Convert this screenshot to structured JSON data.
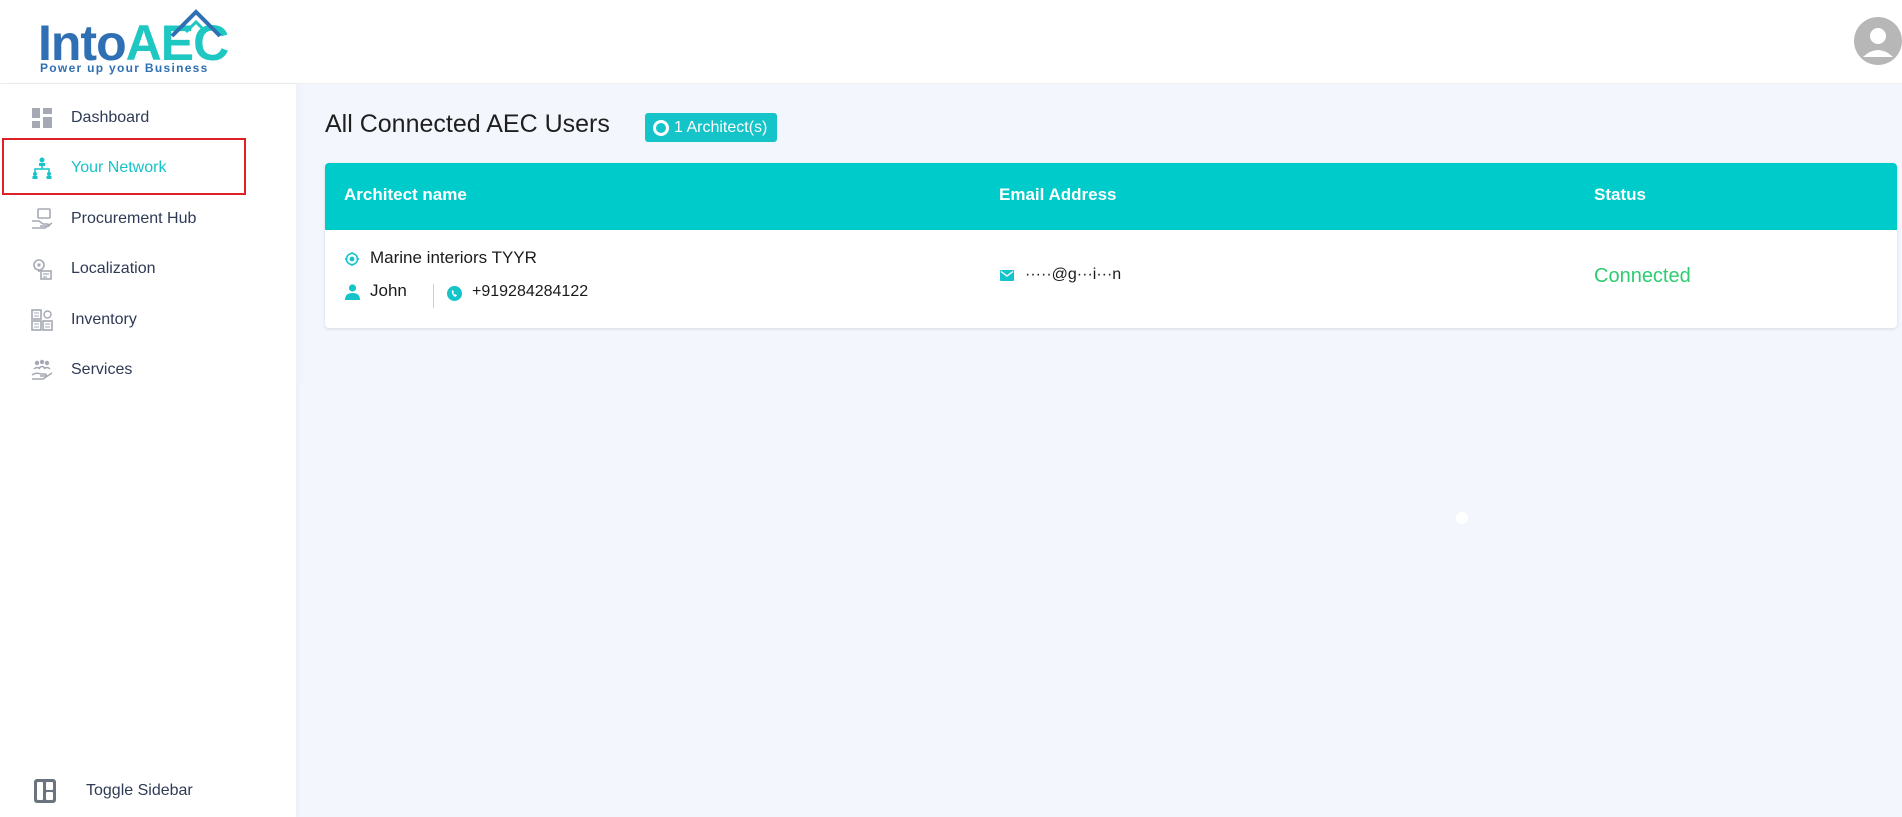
{
  "brand": {
    "logo_main": "Into",
    "logo_accent": "AEC",
    "tagline": "Power up your Business",
    "colors": {
      "primary": "#2f6fb3",
      "accent": "#1fc7c3",
      "highlight": "#dd1f26"
    }
  },
  "header": {
    "avatar_icon": "user-avatar-icon"
  },
  "sidebar": {
    "items": [
      {
        "label": "Dashboard",
        "icon": "dashboard-icon",
        "active": false
      },
      {
        "label": "Your Network",
        "icon": "network-icon",
        "active": true
      },
      {
        "label": "Procurement Hub",
        "icon": "procurement-icon",
        "active": false
      },
      {
        "label": "Localization",
        "icon": "localization-icon",
        "active": false
      },
      {
        "label": "Inventory",
        "icon": "inventory-icon",
        "active": false
      },
      {
        "label": "Services",
        "icon": "services-icon",
        "active": false
      }
    ],
    "toggle_label": "Toggle Sidebar"
  },
  "main": {
    "title": "All Connected AEC Users",
    "badge": "1 Architect(s)",
    "table": {
      "columns": [
        "Architect name",
        "Email Address",
        "Status"
      ],
      "rows": [
        {
          "company": "Marine interiors TYYR",
          "contact": "John",
          "phone": "+919284284122",
          "email": "·····@g···i···n",
          "status": "Connected"
        }
      ]
    }
  }
}
